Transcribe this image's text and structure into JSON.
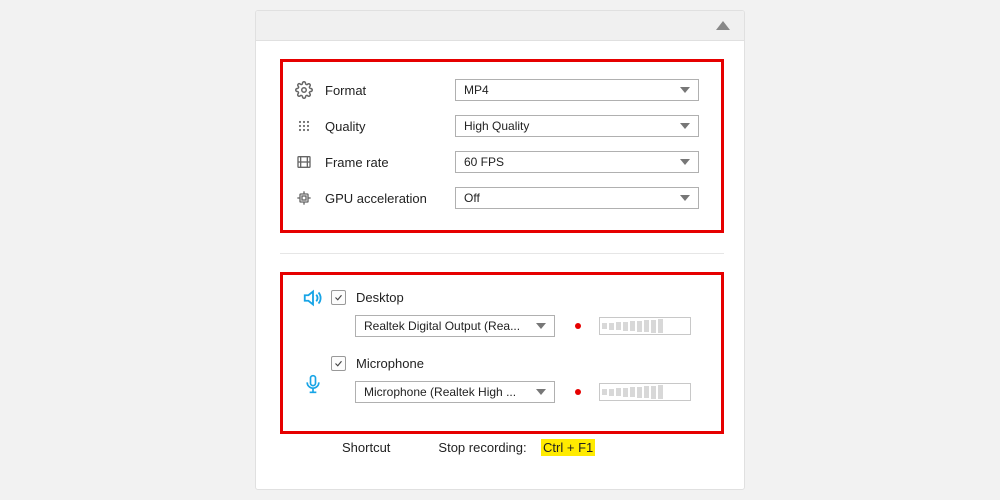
{
  "video": {
    "format": {
      "label": "Format",
      "value": "MP4"
    },
    "quality": {
      "label": "Quality",
      "value": "High Quality"
    },
    "framerate": {
      "label": "Frame rate",
      "value": "60 FPS"
    },
    "gpu": {
      "label": "GPU acceleration",
      "value": "Off"
    }
  },
  "audio": {
    "desktop": {
      "label": "Desktop",
      "checked": true,
      "device": "Realtek Digital Output (Rea..."
    },
    "mic": {
      "label": "Microphone",
      "checked": true,
      "device": "Microphone (Realtek High ..."
    }
  },
  "footer": {
    "shortcut_label": "Shortcut",
    "stop_label": "Stop recording:",
    "shortcut_key": "Ctrl + F1"
  }
}
